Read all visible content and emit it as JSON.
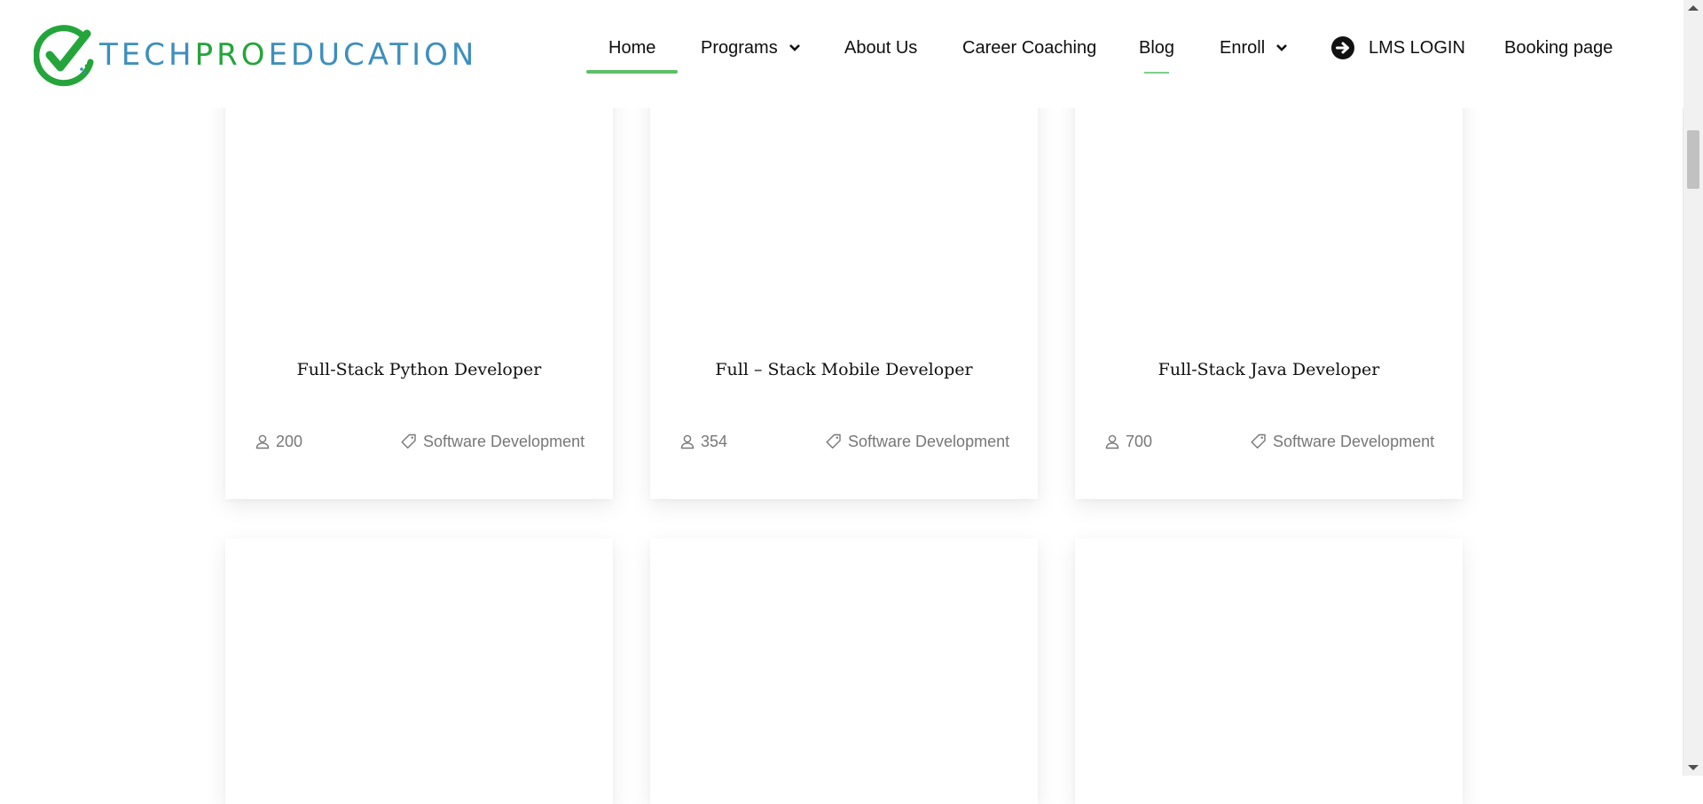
{
  "brand": {
    "part1": "TECH",
    "part2": "PRO",
    "part3": "EDUCATION",
    "colors": {
      "blue": "#3d8fbd",
      "green": "#24a53b"
    }
  },
  "nav": {
    "items": [
      {
        "label": "Home",
        "active": true
      },
      {
        "label": "Programs",
        "dropdown": true
      },
      {
        "label": "About Us"
      },
      {
        "label": "Career Coaching"
      },
      {
        "label": "Blog"
      },
      {
        "label": "Enroll",
        "dropdown": true
      },
      {
        "label": "LMS LOGIN",
        "icon": "arrow-circle-right-icon"
      },
      {
        "label": "Booking page"
      }
    ],
    "accent": "#5cc066"
  },
  "courses": [
    {
      "title": "Full-Stack Python Developer",
      "students": "200",
      "category": "Software Development"
    },
    {
      "title": "Full – Stack Mobile Developer",
      "students": "354",
      "category": "Software Development"
    },
    {
      "title": "Full-Stack Java Developer",
      "students": "700",
      "category": "Software Development"
    }
  ],
  "icons": {
    "students": "user-icon",
    "category": "tag-icon"
  }
}
